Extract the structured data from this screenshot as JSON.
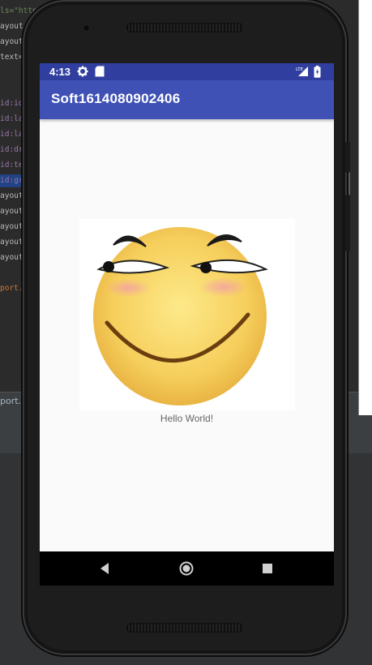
{
  "ide": {
    "code_lines": [
      {
        "text": "ls=\"http",
        "kind": "str"
      },
      {
        "text": "ayout_",
        "kind": "attr"
      },
      {
        "text": "ayout_",
        "kind": "attr"
      },
      {
        "text": "text=",
        "kind": "attr"
      },
      {
        "text": "",
        "kind": "attr"
      },
      {
        "text": "",
        "kind": "attr"
      },
      {
        "text": "id:id=",
        "kind": "id"
      },
      {
        "text": "id:la",
        "kind": "id"
      },
      {
        "text": "id:la",
        "kind": "id"
      },
      {
        "text": "id:dr",
        "kind": "id"
      },
      {
        "text": "id:te",
        "kind": "id"
      },
      {
        "text": "id:gr",
        "kind": "id"
      },
      {
        "text": "ayout_",
        "kind": "attr"
      },
      {
        "text": "ayout_",
        "kind": "attr"
      },
      {
        "text": "ayout_",
        "kind": "attr"
      },
      {
        "text": "ayout_",
        "kind": "attr"
      },
      {
        "text": "ayout_",
        "kind": "attr"
      },
      {
        "text": "",
        "kind": "attr"
      },
      {
        "text": "port.c",
        "kind": "yel"
      }
    ],
    "status_text": "port.co"
  },
  "device": {
    "status_bar": {
      "time": "4:13",
      "icons": [
        "gear-icon",
        "sd-card-icon",
        "lte-signal-icon",
        "battery-icon"
      ],
      "network": "LTE"
    },
    "app_title": "Soft1614080902406",
    "hello_text": "Hello World!",
    "nav_icons": [
      "back-icon",
      "home-icon",
      "recents-icon"
    ],
    "colors": {
      "status_bar": "#303f9f",
      "app_bar": "#3f51b5",
      "screen_bg": "#fafafa"
    }
  }
}
